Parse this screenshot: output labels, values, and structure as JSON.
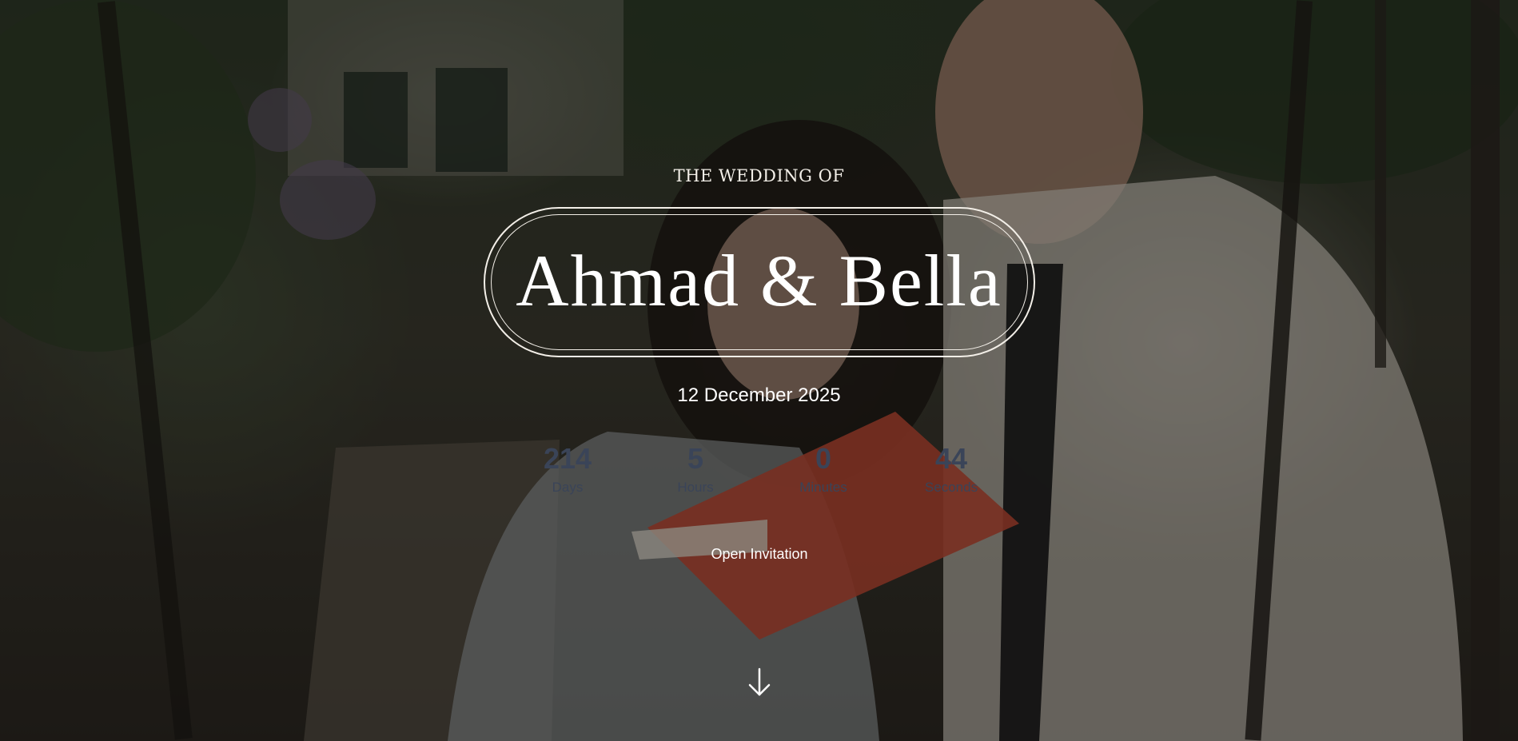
{
  "hero": {
    "eyebrow": "THE WEDDING OF",
    "couple_names": "Ahmad & Bella",
    "date": "12 December 2025"
  },
  "countdown": [
    {
      "value": "214",
      "label": "Days"
    },
    {
      "value": "5",
      "label": "Hours"
    },
    {
      "value": "0",
      "label": "Minutes"
    },
    {
      "value": "44",
      "label": "Seconds"
    }
  ],
  "actions": {
    "open_invitation_label": "Open Invitation",
    "scroll_icon": "arrow-down-icon"
  },
  "colors": {
    "text": "#ffffff",
    "countdown_text": "#3a4458",
    "frame": "#f3efe8"
  }
}
